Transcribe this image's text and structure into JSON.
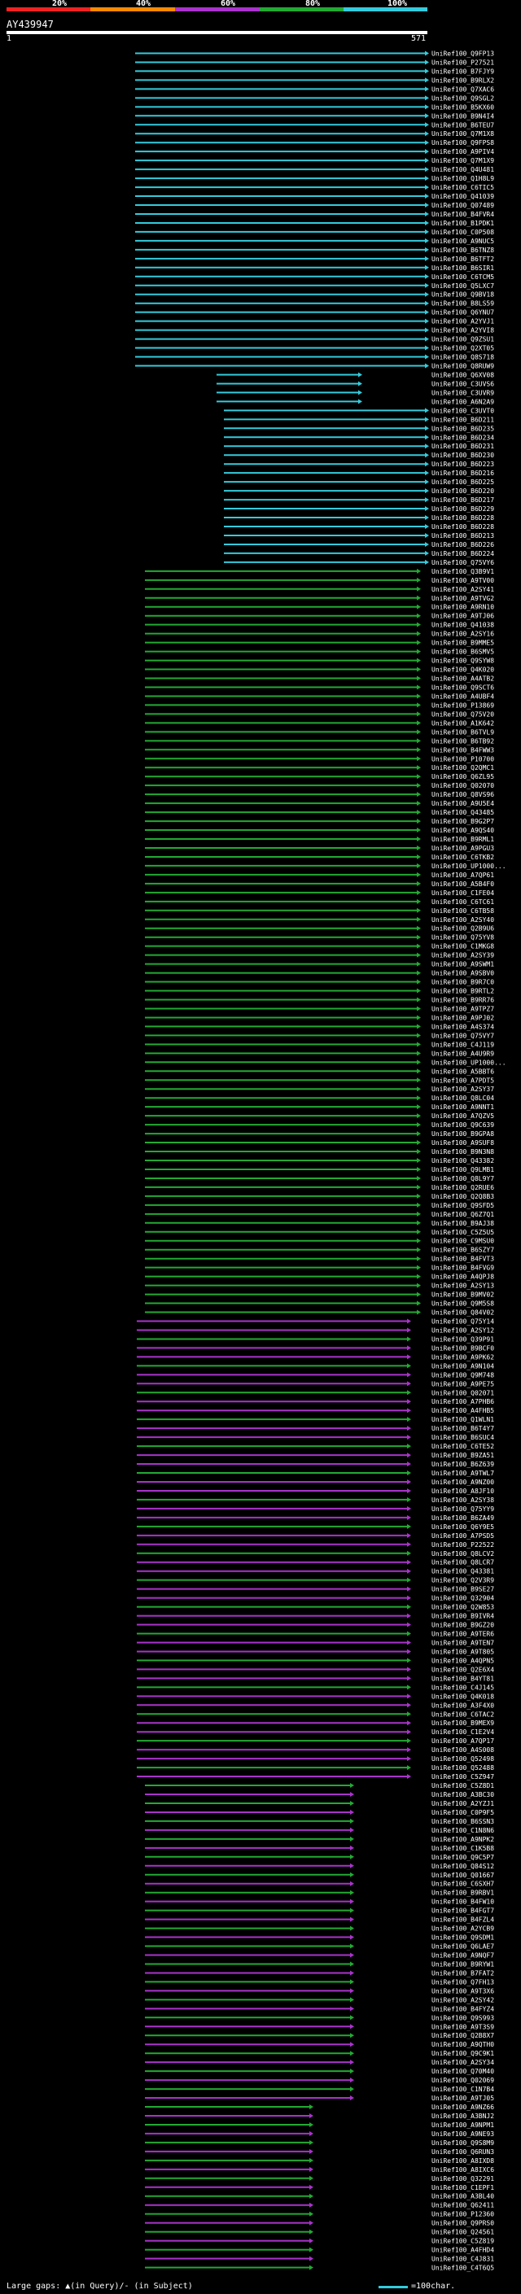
{
  "header": {
    "percent_labels": [
      "20%",
      "40%",
      "60%",
      "80%",
      "100%"
    ],
    "colors": {
      "0-20": "#ee2222",
      "20-40": "#ff8800",
      "40-60": "#aa33cc",
      "60-80": "#22aa33",
      "80-100": "#33ccdd"
    }
  },
  "query": {
    "id": "AY439947",
    "start": "1",
    "end": "571"
  },
  "hits": [
    "UniRef100_Q9FP13",
    "UniRef100_P27521",
    "UniRef100_B7FJY9",
    "UniRef100_B9RLX2",
    "UniRef100_Q7XAC6",
    "UniRef100_Q9SGL2",
    "UniRef100_B5KX60",
    "UniRef100_B9N4I4",
    "UniRef100_B6TEU7",
    "UniRef100_Q7M1X8",
    "UniRef100_Q9FPS8",
    "UniRef100_A9PIV4",
    "UniRef100_Q7M1X9",
    "UniRef100_Q4U481",
    "UniRef100_Q1H8L9",
    "UniRef100_C6TIC5",
    "UniRef100_Q41039",
    "UniRef100_Q07489",
    "UniRef100_B4FVR4",
    "UniRef100_B1PDK1",
    "UniRef100_C0P508",
    "UniRef100_A9NUC5",
    "UniRef100_B6TNZ8",
    "UniRef100_B6TFT2",
    "UniRef100_B6SIR1",
    "UniRef100_C6TCM5",
    "UniRef100_Q5LXC7",
    "UniRef100_Q9BV18",
    "UniRef100_B8LS59",
    "UniRef100_Q6YNU7",
    "UniRef100_A2YVJ1",
    "UniRef100_A2YVI8",
    "UniRef100_Q9ZSU1",
    "UniRef100_Q2XT05",
    "UniRef100_Q8S718",
    "UniRef100_Q8RUW9",
    "UniRef100_Q6XV08",
    "UniRef100_C3UVS6",
    "UniRef100_C3UVR9",
    "UniRef100_A6N2A9",
    "UniRef100_C3UVT0",
    "UniRef100_B6D211",
    "UniRef100_B6D235",
    "UniRef100_B6D234",
    "UniRef100_B6D231",
    "UniRef100_B6D230",
    "UniRef100_B6D223",
    "UniRef100_B6D216",
    "UniRef100_B6D225",
    "UniRef100_B6D220",
    "UniRef100_B6D217",
    "UniRef100_B6D229",
    "UniRef100_B6D228",
    "UniRef100_B6D228",
    "UniRef100_B6D213",
    "UniRef100_B6D226",
    "UniRef100_B6D224",
    "UniRef100_Q75VY6",
    "UniRef100_Q3B9V1",
    "UniRef100_A9TV00",
    "UniRef100_A2SY41",
    "UniRef100_A9TVG2",
    "UniRef100_A9RN10",
    "UniRef100_A9TJ06",
    "UniRef100_Q41038",
    "UniRef100_A2SY16",
    "UniRef100_B9MME5",
    "UniRef100_B6SMV5",
    "UniRef100_Q9SYW8",
    "UniRef100_Q4K020",
    "UniRef100_A4ATB2",
    "UniRef100_Q9SCT6",
    "UniRef100_A4UBF4",
    "UniRef100_P13869",
    "UniRef100_Q75V20",
    "UniRef100_A1K642",
    "UniRef100_B6TVL9",
    "UniRef100_B6TB92",
    "UniRef100_B4FWW3",
    "UniRef100_P10700",
    "UniRef100_Q2QMC1",
    "UniRef100_Q6ZL95",
    "UniRef100_Q02070",
    "UniRef100_Q8VS96",
    "UniRef100_A9U5E4",
    "UniRef100_Q43485",
    "UniRef100_B9G2P7",
    "UniRef100_A9QS40",
    "UniRef100_B9RML1",
    "UniRef100_A9PGU3",
    "UniRef100_C6TKB2",
    "UniRef100_UP1000...",
    "UniRef100_A7QP61",
    "UniRef100_A5B4F0",
    "UniRef100_C1FE04",
    "UniRef100_C6TC61",
    "UniRef100_C6TB58",
    "UniRef100_A2SY40",
    "UniRef100_Q2B9U6",
    "UniRef100_Q75YV8",
    "UniRef100_C1MKG8",
    "UniRef100_A2SY39",
    "UniRef100_A9SWM1",
    "UniRef100_A9SBV0",
    "UniRef100_B9R7C0",
    "UniRef100_B9RTL2",
    "UniRef100_B9RR76",
    "UniRef100_A9TPZ7",
    "UniRef100_A9PJ02",
    "UniRef100_A4S374",
    "UniRef100_Q75VY7",
    "UniRef100_C4J119",
    "UniRef100_A4U9R9",
    "UniRef100_UP1000...",
    "UniRef100_A5BBT6",
    "UniRef100_A7PDT5",
    "UniRef100_A2SY37",
    "UniRef100_Q8LC04",
    "UniRef100_A9NNT1",
    "UniRef100_A7QZV5",
    "UniRef100_Q9C639",
    "UniRef100_B9GPA8",
    "UniRef100_A9SUF8",
    "UniRef100_B9N3N8",
    "UniRef100_Q43382",
    "UniRef100_Q9LMB1",
    "UniRef100_Q8L9Y7",
    "UniRef100_Q2RUE6",
    "UniRef100_Q2Q8B3",
    "UniRef100_Q9SFD5",
    "UniRef100_Q6Z7Q1",
    "UniRef100_B9AJ38",
    "UniRef100_C5Z5U5",
    "UniRef100_C9MSU0",
    "UniRef100_B6SZY7",
    "UniRef100_B4FVT3",
    "UniRef100_B4FVG9",
    "UniRef100_A4QPJ8",
    "UniRef100_A2SY13",
    "UniRef100_B9MV02",
    "UniRef100_Q9M5S8",
    "UniRef100_Q84V02",
    "UniRef100_Q75Y14",
    "UniRef100_A2SY12",
    "UniRef100_Q39P91",
    "UniRef100_B9BCF0",
    "UniRef100_A9PK62",
    "UniRef100_A9N104",
    "UniRef100_Q9M748",
    "UniRef100_A9PE75",
    "UniRef100_Q02071",
    "UniRef100_A7PHB6",
    "UniRef100_A4FHB5",
    "UniRef100_Q1WLN1",
    "UniRef100_B6T4Y7",
    "UniRef100_B6SUC4",
    "UniRef100_C6TE52",
    "UniRef100_B9ZA51",
    "UniRef100_B6Z639",
    "UniRef100_A9TWL7",
    "UniRef100_A9NZ00",
    "UniRef100_A8JF10",
    "UniRef100_A2SY38",
    "UniRef100_Q75YY9",
    "UniRef100_B6ZA49",
    "UniRef100_Q6Y9E5",
    "UniRef100_A7PSD5",
    "UniRef100_P22522",
    "UniRef100_Q8LCV2",
    "UniRef100_Q8LCR7",
    "UniRef100_Q43381",
    "UniRef100_Q2V3R9",
    "UniRef100_B9SE27",
    "UniRef100_Q32904",
    "UniRef100_Q2W853",
    "UniRef100_B9IVR4",
    "UniRef100_B9GZ20",
    "UniRef100_A9TER6",
    "UniRef100_A9TEN7",
    "UniRef100_A9T805",
    "UniRef100_A4QPN5",
    "UniRef100_Q2E6X4",
    "UniRef100_B4YT81",
    "UniRef100_C4J145",
    "UniRef100_Q4K018",
    "UniRef100_A3F4X0",
    "UniRef100_C6TAC2",
    "UniRef100_B9MEX9",
    "UniRef100_C1E2V4",
    "UniRef100_A7QP17",
    "UniRef100_A4S008",
    "UniRef100_Q52498",
    "UniRef100_Q52488",
    "UniRef100_C5Z947",
    "UniRef100_C5Z8D1",
    "UniRef100_A3BC30",
    "UniRef100_A2YZJ1",
    "UniRef100_C0P9F5",
    "UniRef100_B6SSN3",
    "UniRef100_C1N8N6",
    "UniRef100_A9NPK2",
    "UniRef100_C1K5B8",
    "UniRef100_Q9C5P7",
    "UniRef100_Q84S12",
    "UniRef100_Q01667",
    "UniRef100_C6SXH7",
    "UniRef100_B9RBV1",
    "UniRef100_B4FW10",
    "UniRef100_B4FGT7",
    "UniRef100_B4FZL4",
    "UniRef100_A2YCB9",
    "UniRef100_Q9SDM1",
    "UniRef100_Q6LAE7",
    "UniRef100_A9NQF7",
    "UniRef100_B9RYW1",
    "UniRef100_B7FAT2",
    "UniRef100_Q7FH13",
    "UniRef100_A9T3X6",
    "UniRef100_A2SY42",
    "UniRef100_B4FYZ4",
    "UniRef100_Q9S993",
    "UniRef100_A9T3S9",
    "UniRef100_Q2B8X7",
    "UniRef100_A9QTH0",
    "UniRef100_Q9C9K1",
    "UniRef100_A2SY34",
    "UniRef100_Q70M40",
    "UniRef100_Q02069",
    "UniRef100_C1N7B4",
    "UniRef100_A9TJ05",
    "UniRef100_A9NZ66",
    "UniRef100_A3BNJ2",
    "UniRef100_A9NPM1",
    "UniRef100_A9NE93",
    "UniRef100_Q9S8M9",
    "UniRef100_Q6RUN3",
    "UniRef100_A8IXD8",
    "UniRef100_A8IXC6",
    "UniRef100_Q32291",
    "UniRef100_C1EPF1",
    "UniRef100_A3BL40",
    "UniRef100_Q62411",
    "UniRef100_P12360",
    "UniRef100_Q9PRS0",
    "UniRef100_Q24561",
    "UniRef100_C5Z819",
    "UniRef100_A4FHD4",
    "UniRef100_C4J831",
    "UniRef100_C4T6Q5"
  ],
  "legend": {
    "left": "Large gaps: ▲(in Query)/- (in Subject)",
    "right": "=100char."
  }
}
